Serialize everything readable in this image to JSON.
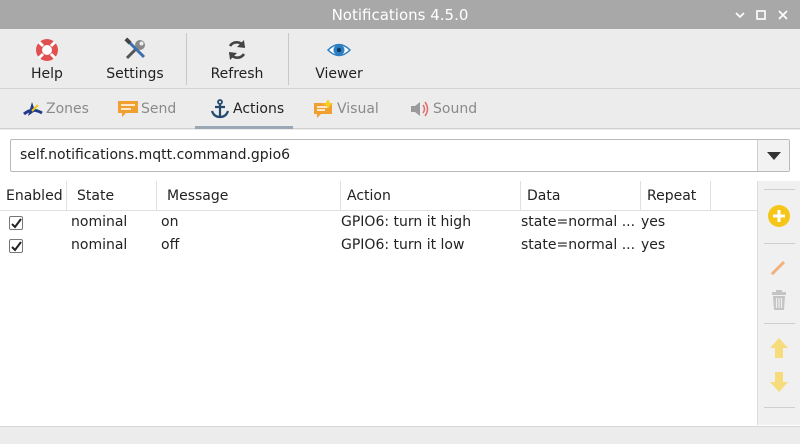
{
  "window": {
    "title": "Notifications 4.5.0"
  },
  "toolbar": {
    "help_label": "Help",
    "settings_label": "Settings",
    "refresh_label": "Refresh",
    "viewer_label": "Viewer"
  },
  "tabs": [
    {
      "label": "Zones",
      "icon": "zones-icon",
      "active": false
    },
    {
      "label": "Send",
      "icon": "message-icon",
      "active": false
    },
    {
      "label": "Actions",
      "icon": "anchor-icon",
      "active": true
    },
    {
      "label": "Visual",
      "icon": "visual-icon",
      "active": false
    },
    {
      "label": "Sound",
      "icon": "speaker-icon",
      "active": false
    }
  ],
  "topic_select": {
    "value": "self.notifications.mqtt.command.gpio6"
  },
  "table": {
    "columns": [
      "Enabled",
      "State",
      "Message",
      "Action",
      "Data",
      "Repeat"
    ],
    "rows": [
      {
        "enabled": true,
        "state": "nominal",
        "message": "on",
        "action": "GPIO6: turn it high",
        "data": "state=normal ...",
        "repeat": "yes"
      },
      {
        "enabled": true,
        "state": "nominal",
        "message": "off",
        "action": "GPIO6: turn it low",
        "data": "state=normal ...",
        "repeat": "yes"
      }
    ]
  },
  "side_actions": [
    "add-icon",
    "edit-icon",
    "delete-icon",
    "move-up-icon",
    "move-down-icon"
  ],
  "colors": {
    "titlebar": "#a8a8a8",
    "accent_yellow": "#f5c518",
    "help_red": "#e05050",
    "viewer_blue": "#2d7fc1"
  }
}
